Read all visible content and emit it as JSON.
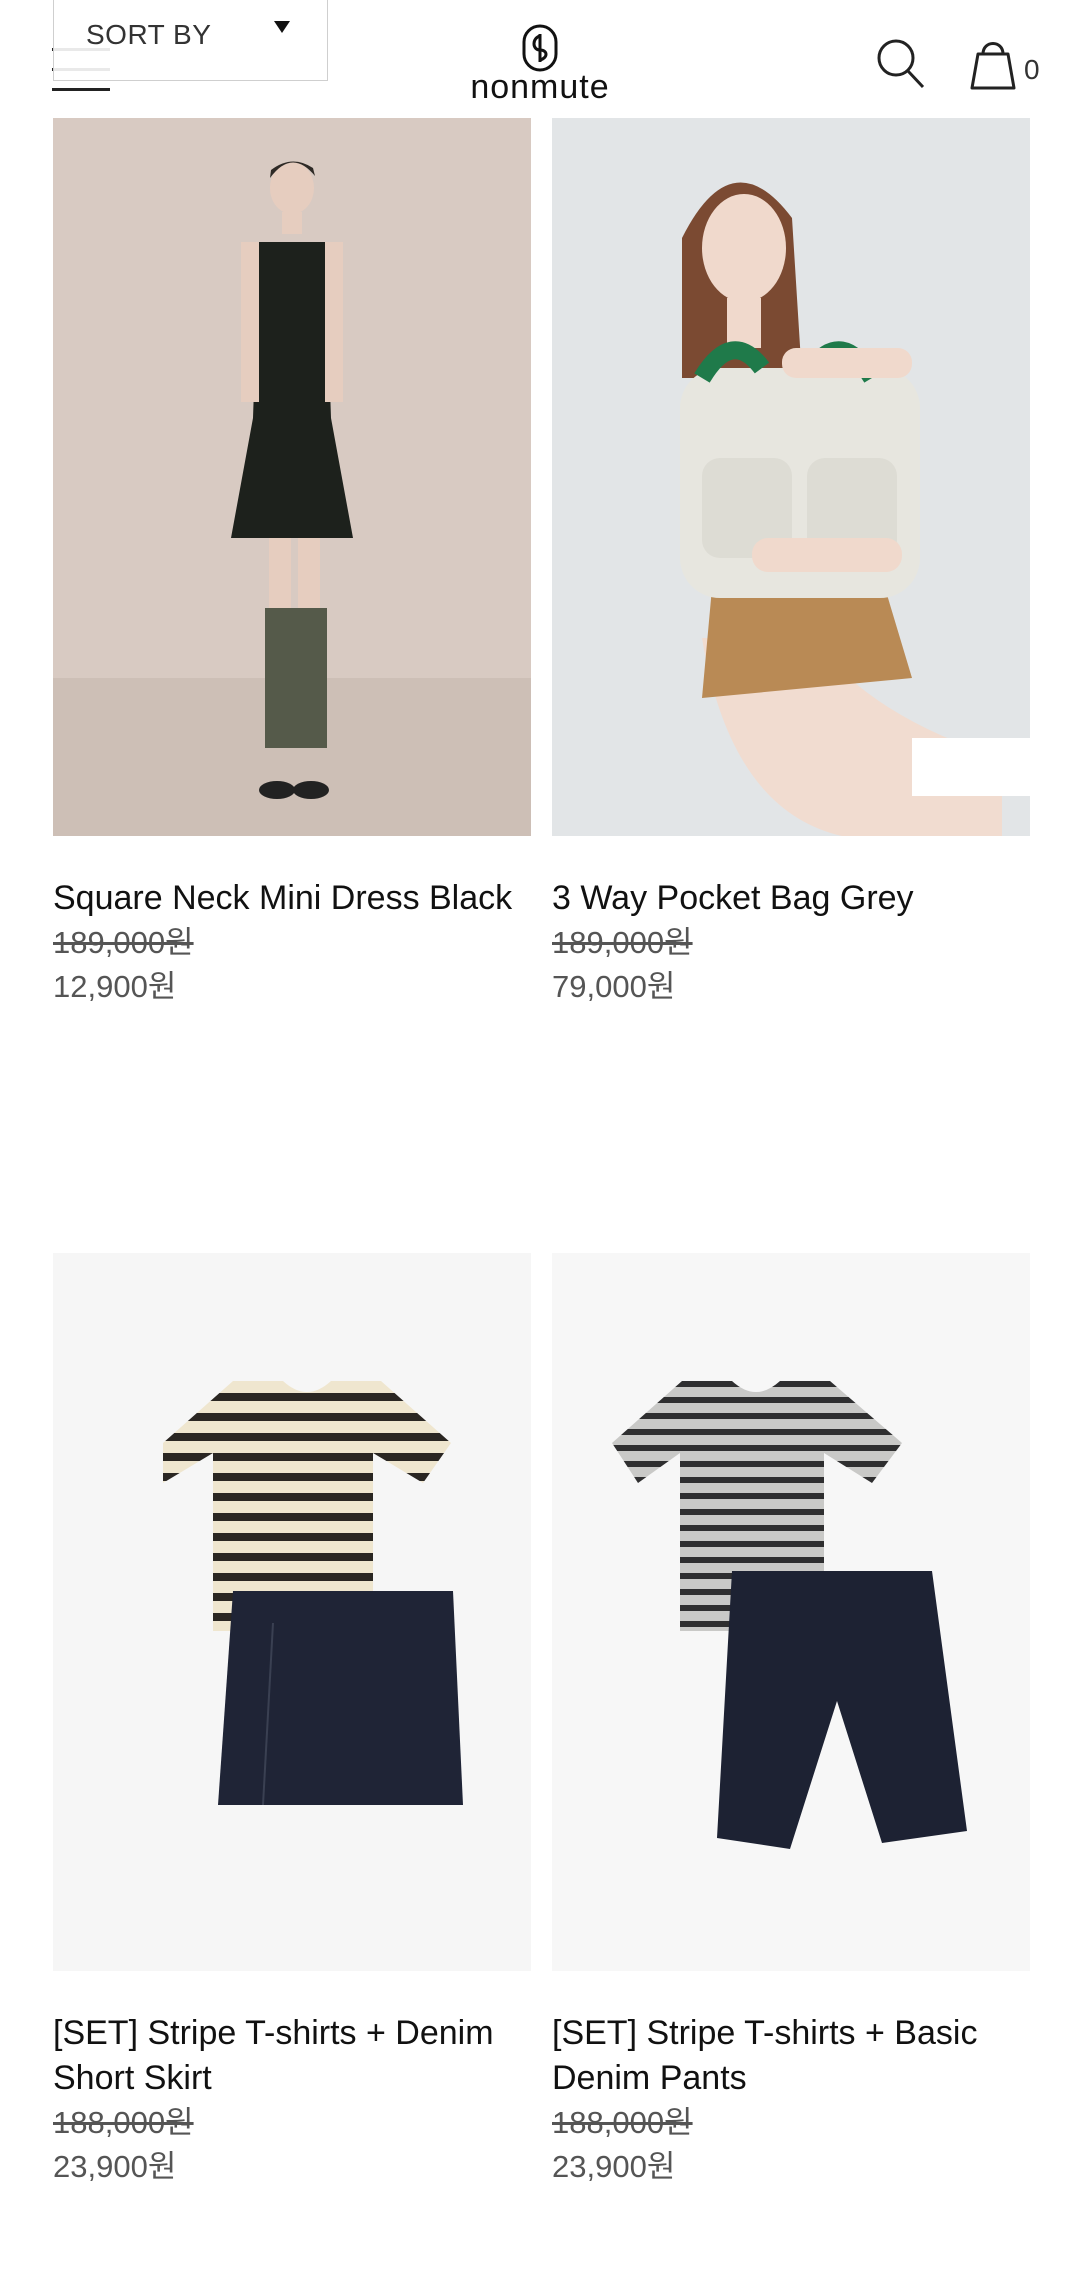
{
  "header": {
    "logo_text": "nonmute",
    "sort_label": "SORT BY",
    "cart_count": "0"
  },
  "products": [
    {
      "name": "Square Neck Mini Dress Black",
      "original_price": "189,000원",
      "sale_price": "12,900원"
    },
    {
      "name": "3 Way Pocket Bag Grey",
      "original_price": "189,000원",
      "sale_price": "79,000원"
    },
    {
      "name": "[SET] Stripe T-shirts + Denim Short Skirt",
      "original_price": "188,000원",
      "sale_price": "23,900원"
    },
    {
      "name": "[SET] Stripe T-shirts + Basic Denim Pants",
      "original_price": "188,000원",
      "sale_price": "23,900원"
    }
  ],
  "colors": {
    "text": "#111111",
    "price": "#555555",
    "photo1_bg": "#d9cbc3",
    "photo2_bg": "#e3e6e8",
    "photo3_bg": "#f5f5f5"
  }
}
